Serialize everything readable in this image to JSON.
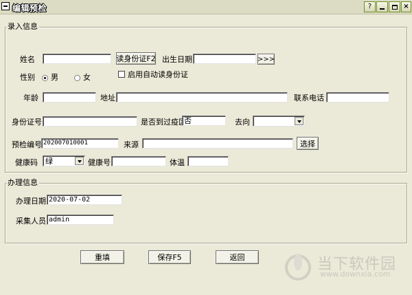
{
  "window": {
    "title": "编辑预检"
  },
  "entry_group": {
    "title": "录入信息",
    "name": {
      "label": "姓名",
      "value": ""
    },
    "read_id_button": "读身份证F2",
    "birth": {
      "label": "出生日期",
      "value": "",
      "button": ">>>"
    },
    "gender": {
      "label": "性别",
      "male": "男",
      "female": "女",
      "selected": "男"
    },
    "auto_read": {
      "label": "启用自动读身份证",
      "checked": false
    },
    "age": {
      "label": "年龄",
      "value": ""
    },
    "address": {
      "label": "地址",
      "value": ""
    },
    "phone": {
      "label": "联系电话",
      "value": ""
    },
    "id_number": {
      "label": "身份证号",
      "value": ""
    },
    "epidemic_area": {
      "label": "是否到过疫区",
      "value": "否"
    },
    "destination": {
      "label": "去向",
      "value": ""
    },
    "precheck_no": {
      "label": "预检编号",
      "value": "202007010001"
    },
    "source": {
      "label": "来源",
      "value": ""
    },
    "select_button": "选择",
    "health_code": {
      "label": "健康码",
      "value": "绿"
    },
    "health_no": {
      "label": "健康号",
      "value": ""
    },
    "temperature": {
      "label": "体温",
      "value": ""
    }
  },
  "process_group": {
    "title": "办理信息",
    "date": {
      "label": "办理日期",
      "value": "2020-07-02"
    },
    "collector": {
      "label": "采集人员",
      "value": "admin"
    }
  },
  "actions": {
    "reset": "重填",
    "save": "保存F5",
    "back": "返回"
  },
  "watermark": {
    "brand": "当下软件园",
    "url": "www.downxia.com"
  }
}
